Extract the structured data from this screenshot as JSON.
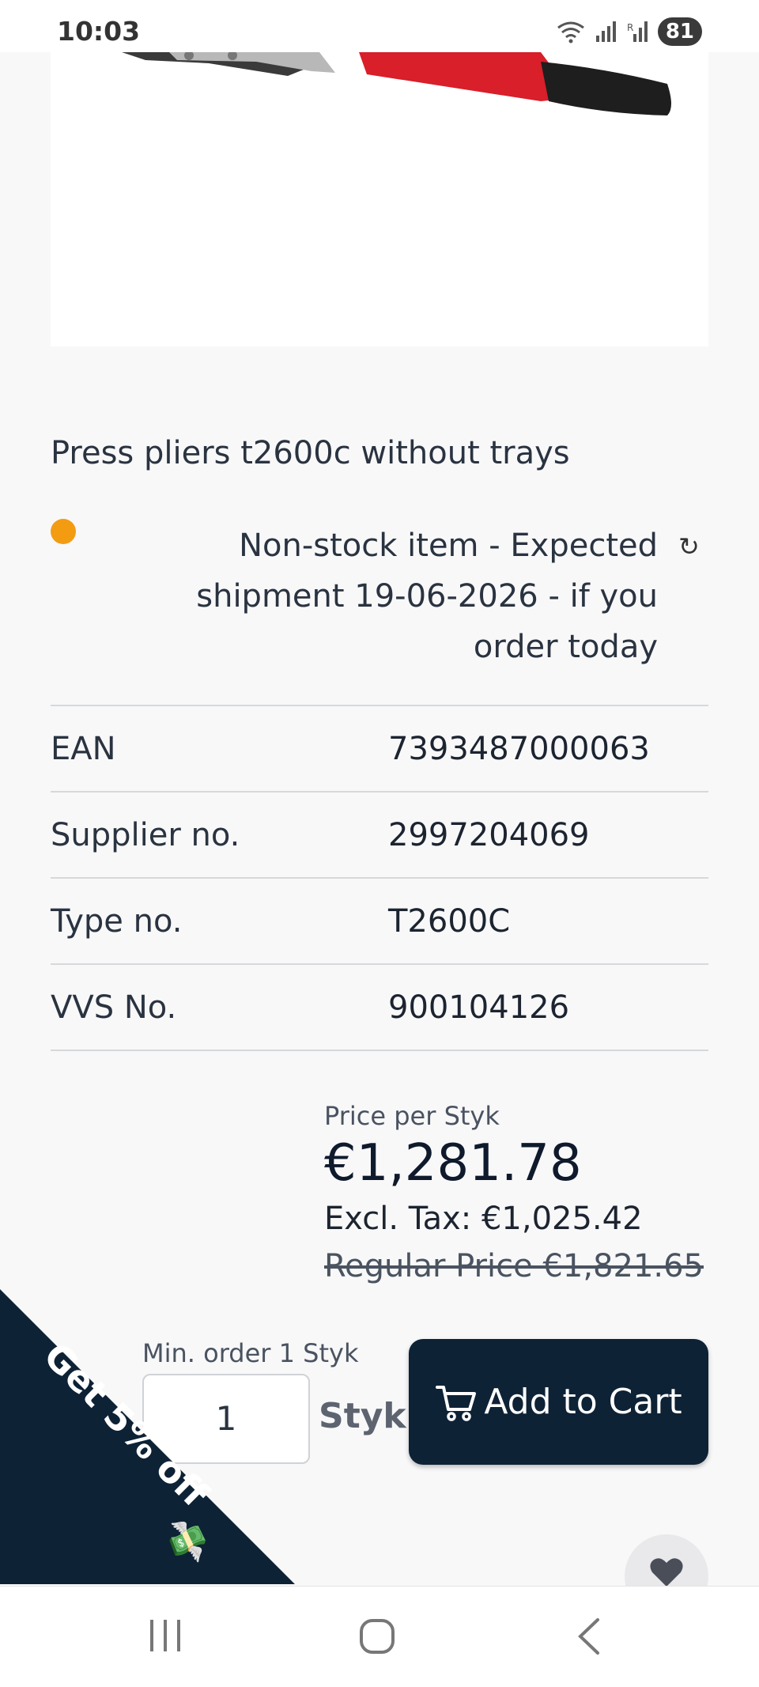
{
  "status_bar": {
    "time": "10:03",
    "battery": "81",
    "icons": [
      "wifi-icon",
      "signal-icon",
      "signal-roaming-icon"
    ]
  },
  "product": {
    "title": "Press pliers t2600c without trays",
    "stock_status_color": "#f39c12",
    "stock_text": "Non-stock item - Expected shipment 19-06-2026 - if you order today",
    "refresh_glyph": "↻"
  },
  "specs": [
    {
      "label": "EAN",
      "value": "7393487000063"
    },
    {
      "label": "Supplier no.",
      "value": "2997204069"
    },
    {
      "label": "Type no.",
      "value": "T2600C"
    },
    {
      "label": "VVS No.",
      "value": "900104126"
    }
  ],
  "price": {
    "per_unit_label": "Price per Styk",
    "amount": "€1,281.78",
    "excl_tax": "Excl. Tax: €1,025.42",
    "regular": "Regular Price €1,821.65"
  },
  "order": {
    "min_order": "Min. order 1 Styk",
    "quantity": "1",
    "unit": "Styk",
    "add_to_cart": "Add to Cart"
  },
  "promo": {
    "text": "Get 5% off",
    "emoji": "💸"
  },
  "colors": {
    "brand_dark": "#0e2236",
    "stock_orange": "#f39c12"
  }
}
